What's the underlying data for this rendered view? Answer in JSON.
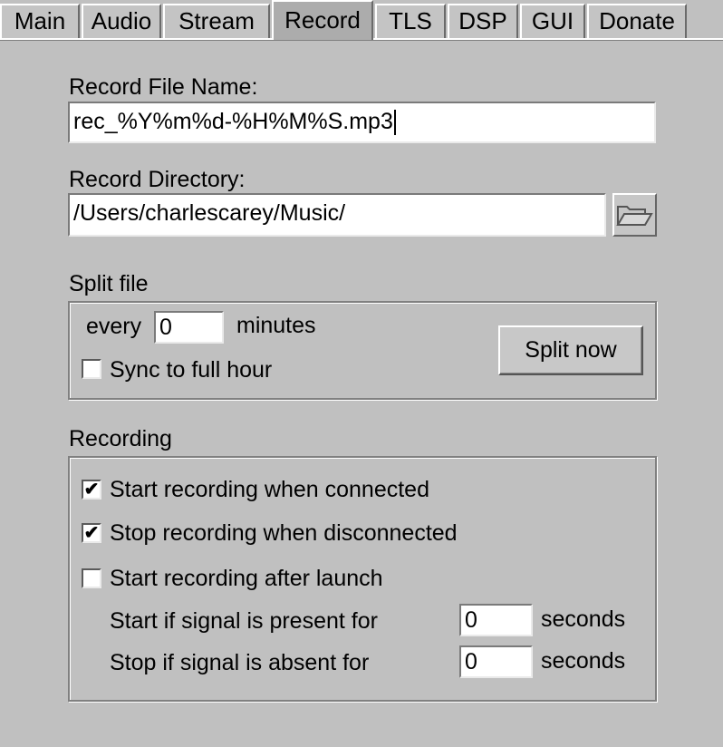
{
  "tabs": [
    {
      "label": "Main"
    },
    {
      "label": "Audio"
    },
    {
      "label": "Stream"
    },
    {
      "label": "Record"
    },
    {
      "label": "TLS"
    },
    {
      "label": "DSP"
    },
    {
      "label": "GUI"
    },
    {
      "label": "Donate"
    }
  ],
  "active_tab": "Record",
  "record_file": {
    "label": "Record File Name:",
    "value": "rec_%Y%m%d-%H%M%S.mp3"
  },
  "record_dir": {
    "label": "Record Directory:",
    "value": "/Users/charlescarey/Music/",
    "browse_icon": "folder-icon"
  },
  "split": {
    "title": "Split file",
    "every_label": "every",
    "minutes_value": "0",
    "minutes_label": "minutes",
    "sync_label": "Sync to full hour",
    "sync_checked": false,
    "split_now_label": "Split now"
  },
  "recording": {
    "title": "Recording",
    "start_connected_label": "Start recording when connected",
    "start_connected_checked": true,
    "stop_disconnected_label": "Stop recording when disconnected",
    "stop_disconnected_checked": true,
    "start_launch_label": "Start recording after launch",
    "start_launch_checked": false,
    "signal_present_label": "Start if signal is present for",
    "signal_present_value": "0",
    "signal_absent_label": "Stop if signal is absent for",
    "signal_absent_value": "0",
    "seconds_label": "seconds"
  },
  "colors": {
    "background": "#c0c0c0",
    "active_tab": "#acacac",
    "field": "#ffffff"
  }
}
